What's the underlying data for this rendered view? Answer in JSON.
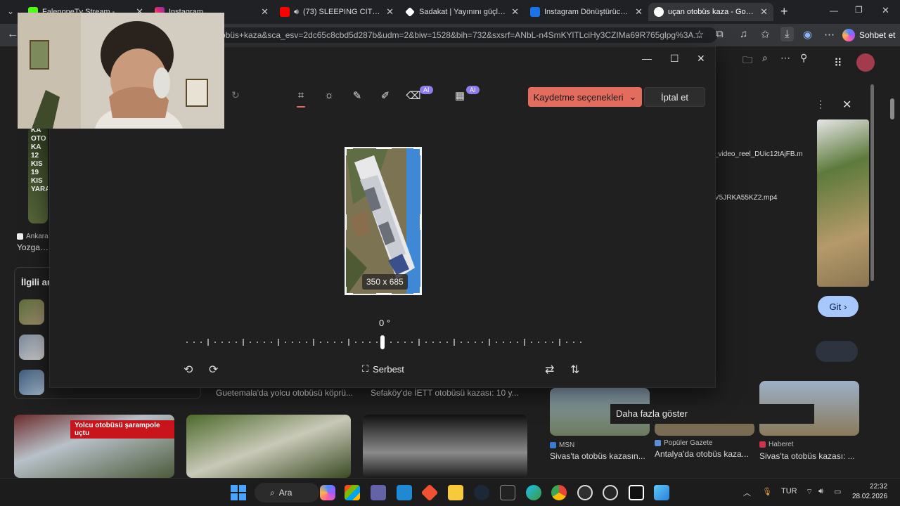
{
  "browser": {
    "tabs": [
      {
        "label": "FaleponeTv Stream - Watch L...",
        "color": "#53fc18"
      },
      {
        "label": "Instagram",
        "color": "#e1306c"
      },
      {
        "label": "(73) SLEEPING CITY FUNK",
        "color": "#ff0000"
      },
      {
        "label": "Sadakat | Yayınını güçlendirme...",
        "color": "#ffffff"
      },
      {
        "label": "Instagram Dönüştürücü - Insta...",
        "color": "#1a73e8"
      },
      {
        "label": "uçan otobüs kaza - Google'da...",
        "color": "#4285f4"
      }
    ],
    "url": "obüs+kaza&sca_esv=2dc65c8cbd5d287b&udm=2&biw=1528&bih=732&sxsrf=ANbL-n4SmKYlTLciHy3CZIMa69R765glpg%3A...",
    "chat_label": "Sohbet et"
  },
  "editor": {
    "save_label": "Kaydetme seçenekleri",
    "cancel_label": "İptal et",
    "ai_badge": "AI",
    "size_label": "350 x 685",
    "angle_label": "0 °",
    "aspect_label": "Serbest"
  },
  "page": {
    "related_title": "İlgili ar",
    "left_source": "Ankara",
    "left_caption": "Yozgat'ta",
    "captions_mid": [
      "Guetemala'da yolcu otobüsü köprü...",
      "Sefaköy'de İETT otobüsü kazası: 10 y..."
    ],
    "overlay_text": "Yolcu otobüsü şarampole uçtu",
    "thumb_text_left": "KA OTO KA 12 KIS 19 KIS YARA",
    "results": [
      {
        "source": "MSN",
        "caption": "Sivas'ta otobüs kazasın...",
        "color": "#3a7bd5"
      },
      {
        "source": "Popüler Gazete",
        "caption": "Antalya'da otobüs kaza...",
        "color": "#5a8fd8"
      },
      {
        "source": "Haberet",
        "caption": "Sivas'ta otobüs kazası: ...",
        "color": "#d0314c"
      }
    ],
    "downloads": [
      {
        "name": "_video_reel_DUic12tAjFB.m"
      },
      {
        "name": "V5JRKA55KZ2.mp4"
      }
    ],
    "git_label": "Git",
    "more_label": "Daha fazla göster"
  },
  "taskbar": {
    "search_label": "Ara",
    "lang": "TUR",
    "time": "22:32",
    "date": "28.02.2026"
  }
}
